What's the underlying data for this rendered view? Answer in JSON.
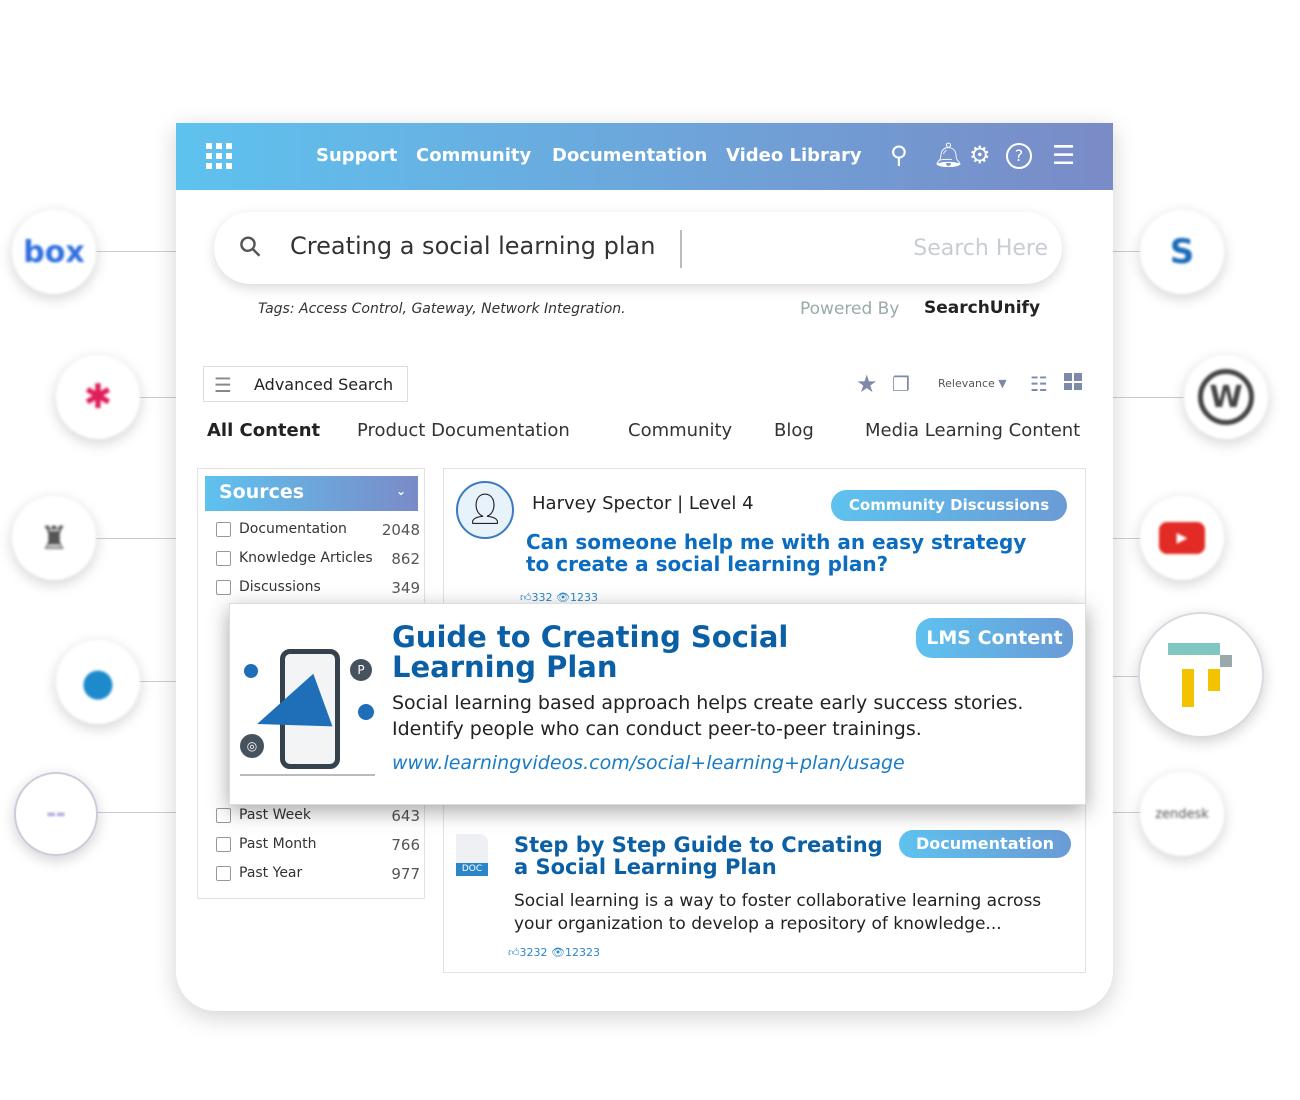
{
  "header": {
    "nav": [
      "Support",
      "Community",
      "Documentation",
      "Video Library"
    ],
    "icons": [
      "apps-grid-icon",
      "search-icon",
      "bell-icon",
      "gear-icon",
      "help-icon",
      "menu-icon"
    ]
  },
  "search": {
    "value": "Creating a social learning plan",
    "placeholder": "Search Here",
    "tags": "Tags: Access Control, Gateway, Network Integration.",
    "powered_by": "Powered By",
    "brand": "SearchUnify"
  },
  "toolbar": {
    "advanced_search": "Advanced Search",
    "sort": "Relevance"
  },
  "tabs": [
    "All Content",
    "Product Documentation",
    "Community",
    "Blog",
    "Media Learning Content"
  ],
  "sources": {
    "title": "Sources",
    "items": [
      {
        "label": "Documentation",
        "count": "2048"
      },
      {
        "label": "Knowledge Articles",
        "count": "862"
      },
      {
        "label": "Discussions",
        "count": "349"
      }
    ]
  },
  "dates": {
    "items": [
      {
        "label": "Past Week",
        "count": "643"
      },
      {
        "label": "Past Month",
        "count": "766"
      },
      {
        "label": "Past Year",
        "count": "977"
      }
    ]
  },
  "results": [
    {
      "author": "Harvey Spector | Level 4",
      "badge": "Community Discussions",
      "title": "Can someone help me with an easy strategy to create a social learning plan?",
      "likes": "332",
      "views": "1233"
    },
    {
      "badge": "LMS Content",
      "title": "Guide to Creating Social Learning Plan",
      "desc": "Social learning based approach helps create early success stories. Identify people who can conduct peer-to-peer trainings.",
      "url": "www.learningvideos.com/social+learning+plan/usage"
    },
    {
      "doc_label": "DOC",
      "badge": "Documentation",
      "title": "Step by Step Guide to Creating a Social Learning Plan",
      "desc": "Social learning is a way to foster collaborative learning across your organization to develop a repository of knowledge...",
      "likes": "3232",
      "views": "12323"
    }
  ],
  "integrations": [
    "box",
    "slack",
    "integration-3",
    "drupal",
    "integration-5",
    "sharepoint",
    "wordpress",
    "youtube",
    "lms-t",
    "zendesk"
  ],
  "logo_text": {
    "box": "box",
    "zendesk": "zendesk"
  },
  "colors": {
    "header_start": "#5ec2ef",
    "header_end": "#7a8bc7",
    "title_blue": "#0b5fa5",
    "link_blue": "#1a7cc4"
  }
}
